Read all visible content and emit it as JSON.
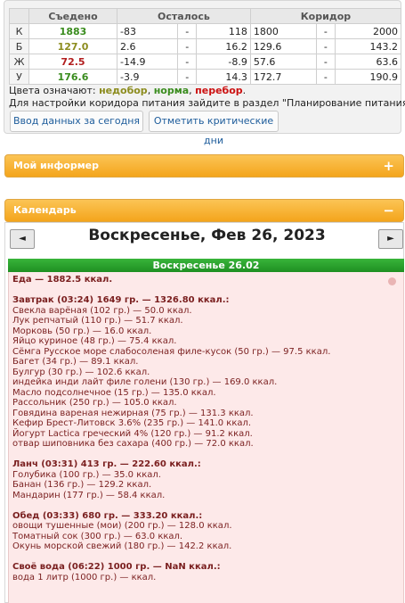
{
  "summary": {
    "headers": [
      "Съедено",
      "Осталось",
      "Коридор"
    ],
    "rows": [
      {
        "label": "К",
        "eaten": "1883",
        "eaten_color": "green",
        "rem_from": "-83",
        "rem_to": "118",
        "cor_from": "1800",
        "cor_to": "2000"
      },
      {
        "label": "Б",
        "eaten": "127.0",
        "eaten_color": "olive",
        "rem_from": "2.6",
        "rem_to": "16.2",
        "cor_from": "129.6",
        "cor_to": "143.2"
      },
      {
        "label": "Ж",
        "eaten": "72.5",
        "eaten_color": "red",
        "rem_from": "-14.9",
        "rem_to": "-8.9",
        "cor_from": "57.6",
        "cor_to": "63.6"
      },
      {
        "label": "У",
        "eaten": "176.6",
        "eaten_color": "green",
        "rem_from": "-3.9",
        "rem_to": "14.3",
        "cor_from": "172.7",
        "cor_to": "190.9"
      }
    ],
    "dash": "-"
  },
  "legend": {
    "prefix": "Цвета означают: ",
    "under": "недобор",
    "norm": "норма",
    "over": "перебор",
    "hint": "Для настройки коридора питания зайдите в раздел \"Планирование питания\"."
  },
  "buttons": {
    "enter_today": "Ввод данных за сегодня",
    "mark_critical": "Отметить критические дни"
  },
  "panels": {
    "informer": "Мой информер",
    "informer_toggle": "+",
    "calendar": "Календарь",
    "calendar_toggle": "−"
  },
  "calendar": {
    "prev": "◄",
    "next": "►",
    "title": "Воскресенье, Фев 26, 2023",
    "day_label": "Воскресенье 26.02"
  },
  "day": {
    "lines": [
      {
        "t": "Еда — 1882.5 ккал.",
        "h": true
      },
      {
        "t": "",
        "gap": true
      },
      {
        "t": "Завтрак (03:24) 1649 гр. — 1326.80 ккал.:",
        "h": true
      },
      {
        "t": "Свекла варёная (102 гр.) — 50.0 ккал."
      },
      {
        "t": "Лук репчатый (110 гр.) — 51.7 ккал."
      },
      {
        "t": "Морковь (50 гр.) — 16.0 ккал."
      },
      {
        "t": "Яйцо куриное (48 гр.) — 75.4 ккал."
      },
      {
        "t": "Сёмга Русское море слабосоленая филе-кусок (50 гр.) — 97.5 ккал."
      },
      {
        "t": "Багет (34 гр.) — 89.1 ккал."
      },
      {
        "t": "Булгур (30 гр.) — 102.6 ккал."
      },
      {
        "t": "индейка инди лайт филе голени (130 гр.) — 169.0 ккал."
      },
      {
        "t": "Масло подсолнечное (15 гр.) — 135.0 ккал."
      },
      {
        "t": "Рассольник (250 гр.) — 105.0 ккал."
      },
      {
        "t": "Говядина вареная нежирная (75 гр.) — 131.3 ккал."
      },
      {
        "t": "Кефир Брест-Литовск 3.6% (235 гр.) — 141.0 ккал."
      },
      {
        "t": "Йогурт Lactica греческий 4% (120 гр.) — 91.2 ккал."
      },
      {
        "t": "отвар шиповника без сахара (400 гр.) — 72.0 ккал."
      },
      {
        "t": "",
        "gap": true
      },
      {
        "t": "Ланч (03:31) 413 гр. — 222.60 ккал.:",
        "h": true
      },
      {
        "t": "Голубика (100 гр.) — 35.0 ккал."
      },
      {
        "t": "Банан (136 гр.) — 129.2 ккал."
      },
      {
        "t": "Мандарин (177 гр.) — 58.4 ккал."
      },
      {
        "t": "",
        "gap": true
      },
      {
        "t": "Обед (03:33) 680 гр. — 333.20 ккал.:",
        "h": true
      },
      {
        "t": "овощи тушенные (мои) (200 гр.) — 128.0 ккал."
      },
      {
        "t": "Томатный сок (300 гр.) — 63.0 ккал."
      },
      {
        "t": "Окунь морской свежий (180 гр.) — 142.2 ккал."
      },
      {
        "t": "",
        "gap": true
      },
      {
        "t": "Своё вода (06:22) 1000 гр. — NaN ккал.:",
        "h": true
      },
      {
        "t": "вода 1 литр (1000 гр.) — ккал."
      }
    ]
  }
}
